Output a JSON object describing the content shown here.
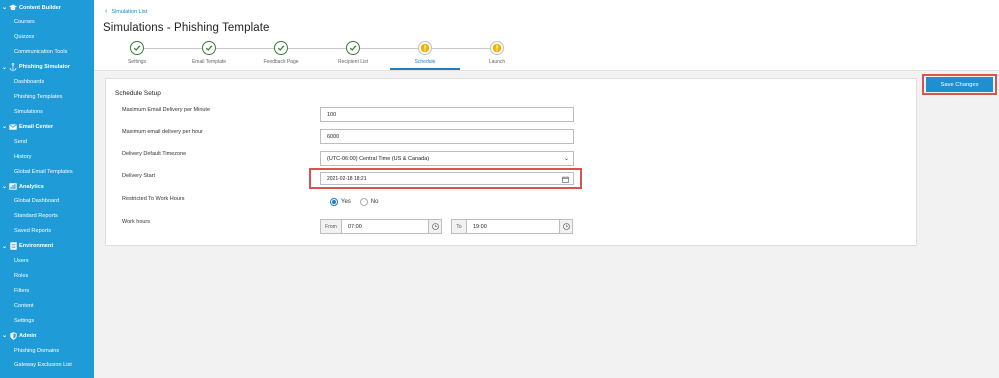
{
  "sidebar": {
    "groups": [
      {
        "label": "Content Builder",
        "icon": "graduation-cap-icon",
        "items": [
          "Courses",
          "Quizzes",
          "Communication Tools"
        ]
      },
      {
        "label": "Phishing Simulator",
        "icon": "anchor-icon",
        "items": [
          "Dashboards",
          "Phishing Templates",
          "Simulations"
        ]
      },
      {
        "label": "Email Center",
        "icon": "envelope-icon",
        "items": [
          "Send",
          "History",
          "Global Email Templates"
        ]
      },
      {
        "label": "Analytics",
        "icon": "bar-chart-icon",
        "items": [
          "Global Dashboard",
          "Standard Reports",
          "Saved Reports"
        ]
      },
      {
        "label": "Environment",
        "icon": "document-icon",
        "items": [
          "Users",
          "Roles",
          "Filters",
          "Content",
          "Settings"
        ]
      },
      {
        "label": "Admin",
        "icon": "shield-icon",
        "items": [
          "Phishing Domains",
          "Gateway Exclusion List"
        ]
      }
    ]
  },
  "header": {
    "breadcrumb": "Simulation List",
    "title": "Simulations - Phishing Template"
  },
  "steps": [
    {
      "label": "Settings",
      "status": "done"
    },
    {
      "label": "Email Template",
      "status": "done"
    },
    {
      "label": "Feedback Page",
      "status": "done"
    },
    {
      "label": "Recipient List",
      "status": "done"
    },
    {
      "label": "Schedule",
      "status": "warning",
      "active": true
    },
    {
      "label": "Launch",
      "status": "warning"
    }
  ],
  "form": {
    "section_title": "Schedule Setup",
    "max_per_minute": {
      "label": "Maximum Email Delivery per Minute",
      "value": "100"
    },
    "max_per_hour": {
      "label": "Maximum email delivery per hour",
      "value": "6000"
    },
    "timezone": {
      "label": "Delivery Default Timezone",
      "value": "(UTC-06:00) Central Time (US & Canada)"
    },
    "delivery_start": {
      "label": "Delivery Start",
      "value": "2021-02-18 18:21"
    },
    "work_hours_restricted": {
      "label": "Restricted To Work Hours",
      "yes": "Yes",
      "no": "No",
      "selected": "Yes"
    },
    "work_hours": {
      "label": "Work hours",
      "from_label": "From",
      "from_value": "07:00",
      "to_label": "To",
      "to_value": "19:00"
    }
  },
  "actions": {
    "save_label": "Save Changes"
  },
  "colors": {
    "sidebar": "#1f9bd7",
    "accent": "#1f7fc4",
    "done": "#3c7a3c",
    "warning": "#f0b400",
    "highlight": "#d9534f"
  }
}
